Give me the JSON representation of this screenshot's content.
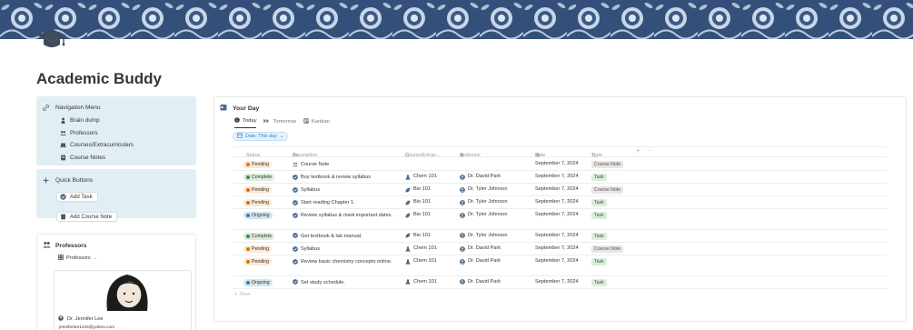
{
  "page": {
    "title": "Academic Buddy"
  },
  "navigation": {
    "title": "Navigation Menu",
    "items": [
      {
        "label": "Brain dump",
        "icon": "person-think-icon"
      },
      {
        "label": "Professors",
        "icon": "people-icon"
      },
      {
        "label": "Courses/Extracurriculars",
        "icon": "laptop-icon"
      },
      {
        "label": "Course Notes",
        "icon": "notebook-icon"
      }
    ]
  },
  "quick_buttons": {
    "title": "Quick Buttons",
    "buttons": [
      {
        "label": "Add Task",
        "icon": "check-circle-icon"
      },
      {
        "label": "Add Course Note",
        "icon": "notebook-icon"
      }
    ]
  },
  "professors": {
    "title": "Professors",
    "view_label": "Professors",
    "card": {
      "name": "Dr. Jennifer Lee",
      "email": "jenniferlee1234@yahoo.com"
    }
  },
  "your_day": {
    "title": "Your Day",
    "tabs": [
      {
        "label": "Today",
        "active": true
      },
      {
        "label": "Tomorrow",
        "active": false
      },
      {
        "label": "Kanban",
        "active": false
      }
    ],
    "filter_label": "Date: This day",
    "columns": {
      "status": "Status",
      "description": "Description",
      "course": "Course/Extrac...",
      "professor": "Professor",
      "date": "Date",
      "type": "Type"
    },
    "rows": [
      {
        "status": "Pending",
        "description": "Course Note",
        "course": "",
        "professor": "",
        "date": "September 7, 2024",
        "type": "Course Note"
      },
      {
        "status": "Complete",
        "description": "Buy textbook & review syllabus",
        "course": "Chem 101",
        "professor": "Dr. David Park",
        "date": "September 7, 2024",
        "type": "Task"
      },
      {
        "status": "Pending",
        "description": "Syllabus",
        "course": "Bio 101",
        "professor": "Dr. Tyler Johnson",
        "date": "September 7, 2024",
        "type": "Course Note"
      },
      {
        "status": "Pending",
        "description": "Start reading Chapter 1.",
        "course": "Bio 101",
        "professor": "Dr. Tyler Johnson",
        "date": "September 7, 2024",
        "type": "Task"
      },
      {
        "status": "Ongoing",
        "description": "Review syllabus & mark important dates.",
        "course": "Bio 101",
        "professor": "Dr. Tyler Johnson",
        "date": "September 7, 2024",
        "type": "Task"
      },
      {
        "status": "Complete",
        "description": "Get textbook & lab manual.",
        "course": "Bio 101",
        "professor": "Dr. Tyler Johnson",
        "date": "September 7, 2024",
        "type": "Task"
      },
      {
        "status": "Pending",
        "description": "Syllabus",
        "course": "Chem 101",
        "professor": "Dr. David Park",
        "date": "September 7, 2024",
        "type": "Course Note"
      },
      {
        "status": "Pending",
        "description": "Review basic chemistry concepts online.",
        "course": "Chem 101",
        "professor": "Dr. David Park",
        "date": "September 7, 2024",
        "type": "Task"
      },
      {
        "status": "Ongoing",
        "description": "Set study schedule.",
        "course": "Chem 101",
        "professor": "Dr. David Park",
        "date": "September 7, 2024",
        "type": "Task"
      }
    ],
    "new_label": "New"
  },
  "colors": {
    "callout_bg": "#e1eef3",
    "status_pending": "#fbe8d5",
    "status_pending_dot": "#d9730d",
    "status_complete": "#dbeddb",
    "status_complete_dot": "#448361",
    "status_ongoing": "#d3e5ef",
    "status_ongoing_dot": "#337ea9",
    "tag_course_note": "#e9e5e3",
    "tag_task": "#dbeddb",
    "accent_blue": "#2383e2"
  }
}
